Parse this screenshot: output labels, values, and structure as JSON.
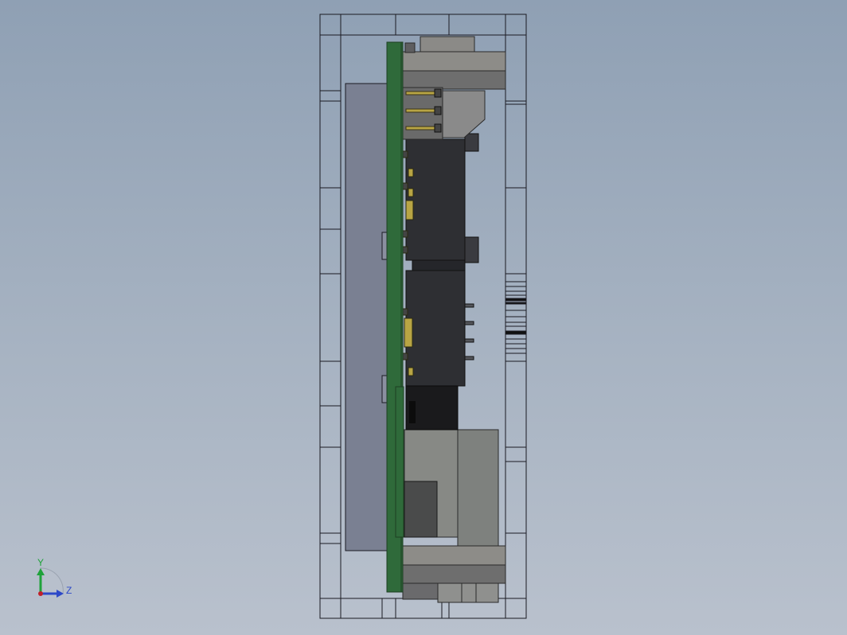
{
  "viewport": {
    "background_top": "#8fa0b4",
    "background_bottom": "#b9c1cd"
  },
  "model": {
    "view": "side view",
    "parts": [
      "enclosure-frame",
      "display-panel",
      "main-pcb",
      "daughter-pcb",
      "top-connector",
      "bottom-connector",
      "pin-header",
      "heatsink-block",
      "module-block"
    ],
    "colors": {
      "pcb": "#2f6a3a",
      "pcb_edge": "#1d3f23",
      "outline": "#1a1a22",
      "panel": "#7a8092",
      "dark_block": "#2e2f33",
      "grey_block": "#7d7f7c",
      "gold_pin": "#b8a544"
    }
  },
  "triad": {
    "y_label": "Y",
    "z_label": "Z",
    "y_color": "#1fa23a",
    "z_color": "#2d49c8",
    "origin_color": "#c0202a"
  }
}
